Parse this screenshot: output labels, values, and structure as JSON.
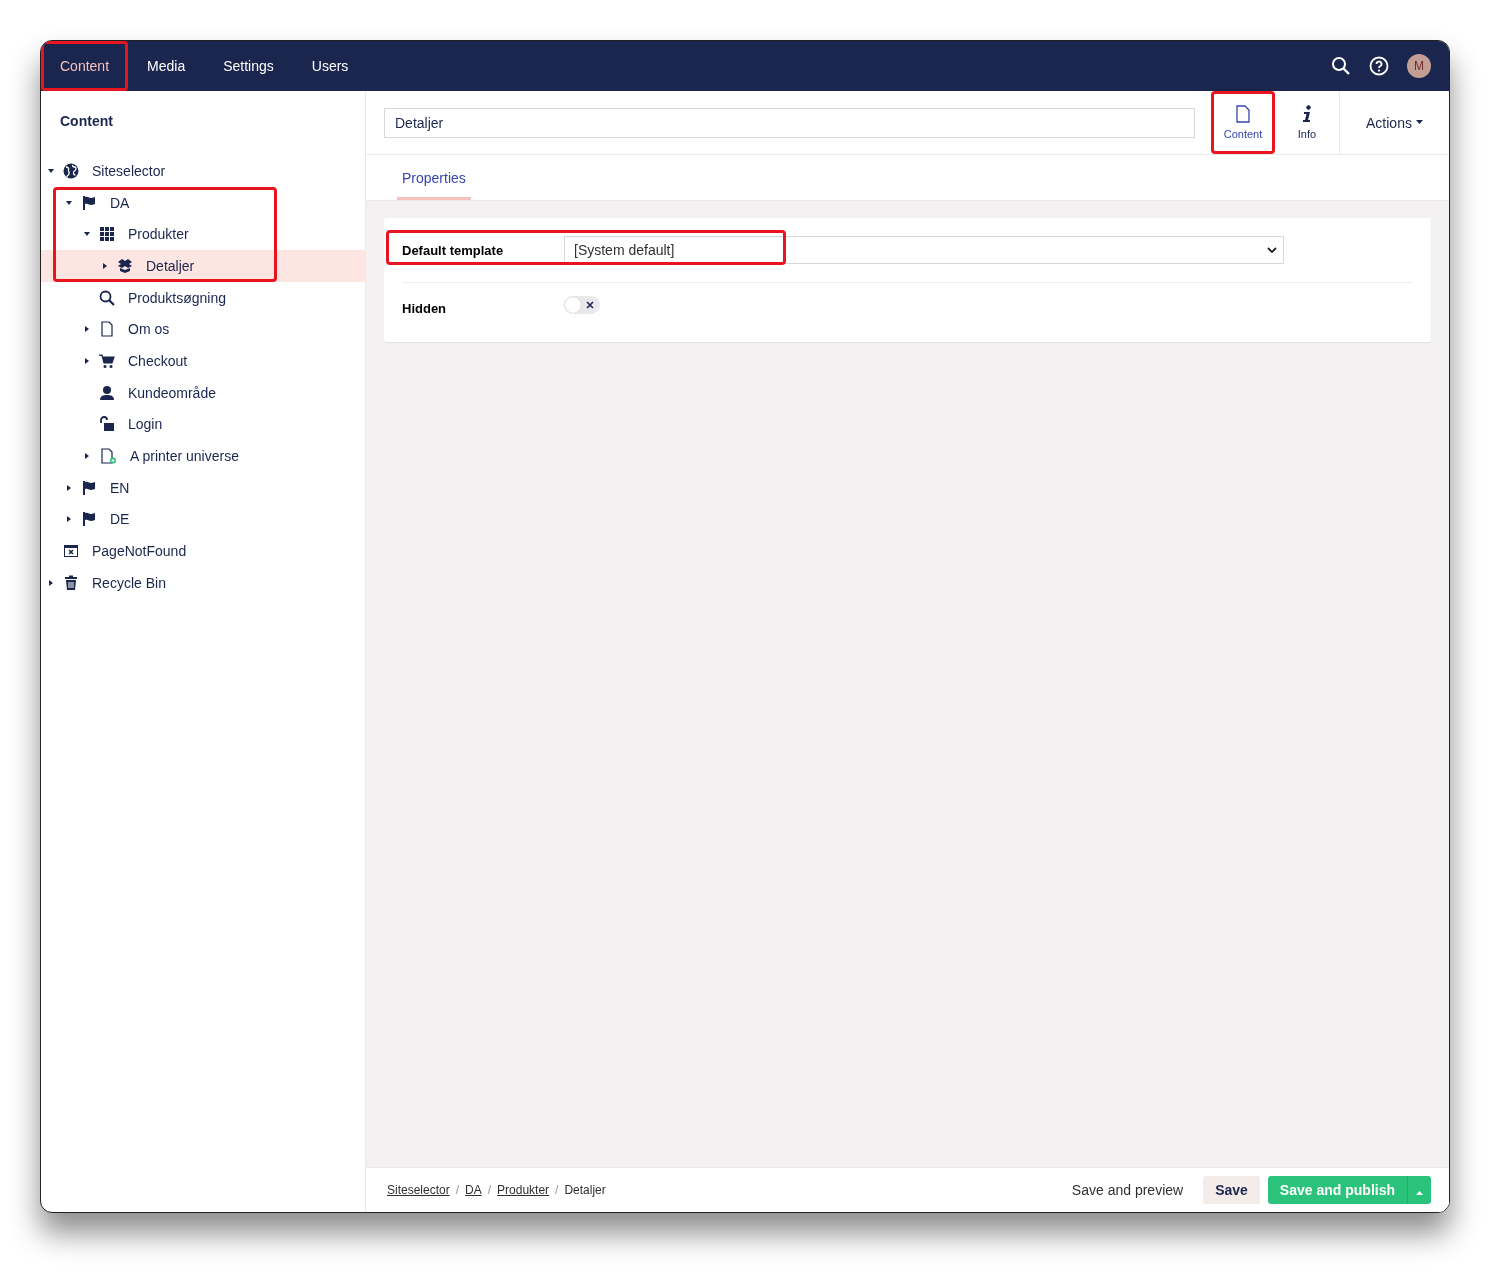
{
  "header": {
    "sections": [
      {
        "label": "Content",
        "selected": true,
        "highlighted": true
      },
      {
        "label": "Media",
        "selected": false,
        "highlighted": false
      },
      {
        "label": "Settings",
        "selected": false,
        "highlighted": false
      },
      {
        "label": "Users",
        "selected": false,
        "highlighted": false
      }
    ],
    "avatar": "M"
  },
  "sidebar": {
    "title": "Content",
    "tree": [
      {
        "label": "Siteselector",
        "kind": "globe",
        "expanded": true,
        "selected": false,
        "highlighted": false,
        "children": [
          {
            "label": "DA",
            "kind": "flag",
            "expanded": true,
            "selected": false,
            "highlighted": true,
            "children": [
              {
                "label": "Produkter",
                "kind": "grid",
                "expanded": true,
                "selected": false,
                "highlighted": true,
                "children": [
                  {
                    "label": "Detaljer",
                    "kind": "boxes",
                    "expanded": false,
                    "selected": true,
                    "highlighted": true
                  }
                ]
              },
              {
                "label": "Produktsøgning",
                "kind": "search",
                "selected": false,
                "highlighted": false
              },
              {
                "label": "Om os",
                "kind": "document",
                "expanded": false,
                "selected": false,
                "highlighted": false
              },
              {
                "label": "Checkout",
                "kind": "cart",
                "expanded": false,
                "selected": false,
                "highlighted": false
              },
              {
                "label": "Kundeområde",
                "kind": "user",
                "selected": false,
                "highlighted": false
              },
              {
                "label": "Login",
                "kind": "unlock",
                "selected": false,
                "highlighted": false
              },
              {
                "label": "A printer universe",
                "kind": "document-add",
                "expanded": false,
                "selected": false,
                "highlighted": false
              }
            ]
          },
          {
            "label": "EN",
            "kind": "flag",
            "expanded": false,
            "selected": false,
            "highlighted": false
          },
          {
            "label": "DE",
            "kind": "flag",
            "expanded": false,
            "selected": false,
            "highlighted": false
          }
        ]
      },
      {
        "label": "PageNotFound",
        "kind": "error-page",
        "selected": false,
        "highlighted": false
      },
      {
        "label": "Recycle Bin",
        "kind": "trash",
        "expanded": false,
        "selected": false,
        "highlighted": false
      }
    ]
  },
  "editor": {
    "name": "Detaljer",
    "apps": [
      {
        "label": "Content",
        "kind": "document",
        "selected": true,
        "highlighted": true
      },
      {
        "label": "Info",
        "kind": "info",
        "selected": false,
        "highlighted": false
      }
    ],
    "actions": "Actions",
    "tabs": [
      {
        "label": "Properties",
        "selected": true
      }
    ],
    "properties": [
      {
        "kind": "select",
        "label": "Default template",
        "value": "[System default]",
        "highlighted": true
      },
      {
        "kind": "toggle",
        "label": "Hidden",
        "on": false
      }
    ]
  },
  "footer": {
    "separator": "/",
    "breadcrumbs": [
      {
        "label": "Siteselector",
        "link": true
      },
      {
        "label": "DA",
        "link": true
      },
      {
        "label": "Produkter",
        "link": true
      },
      {
        "label": "Detaljer",
        "link": false
      }
    ],
    "buttons": [
      {
        "kind": "link",
        "label": "Save and preview"
      },
      {
        "kind": "secondary",
        "label": "Save"
      },
      {
        "kind": "primary",
        "label": "Save and publish"
      }
    ]
  }
}
